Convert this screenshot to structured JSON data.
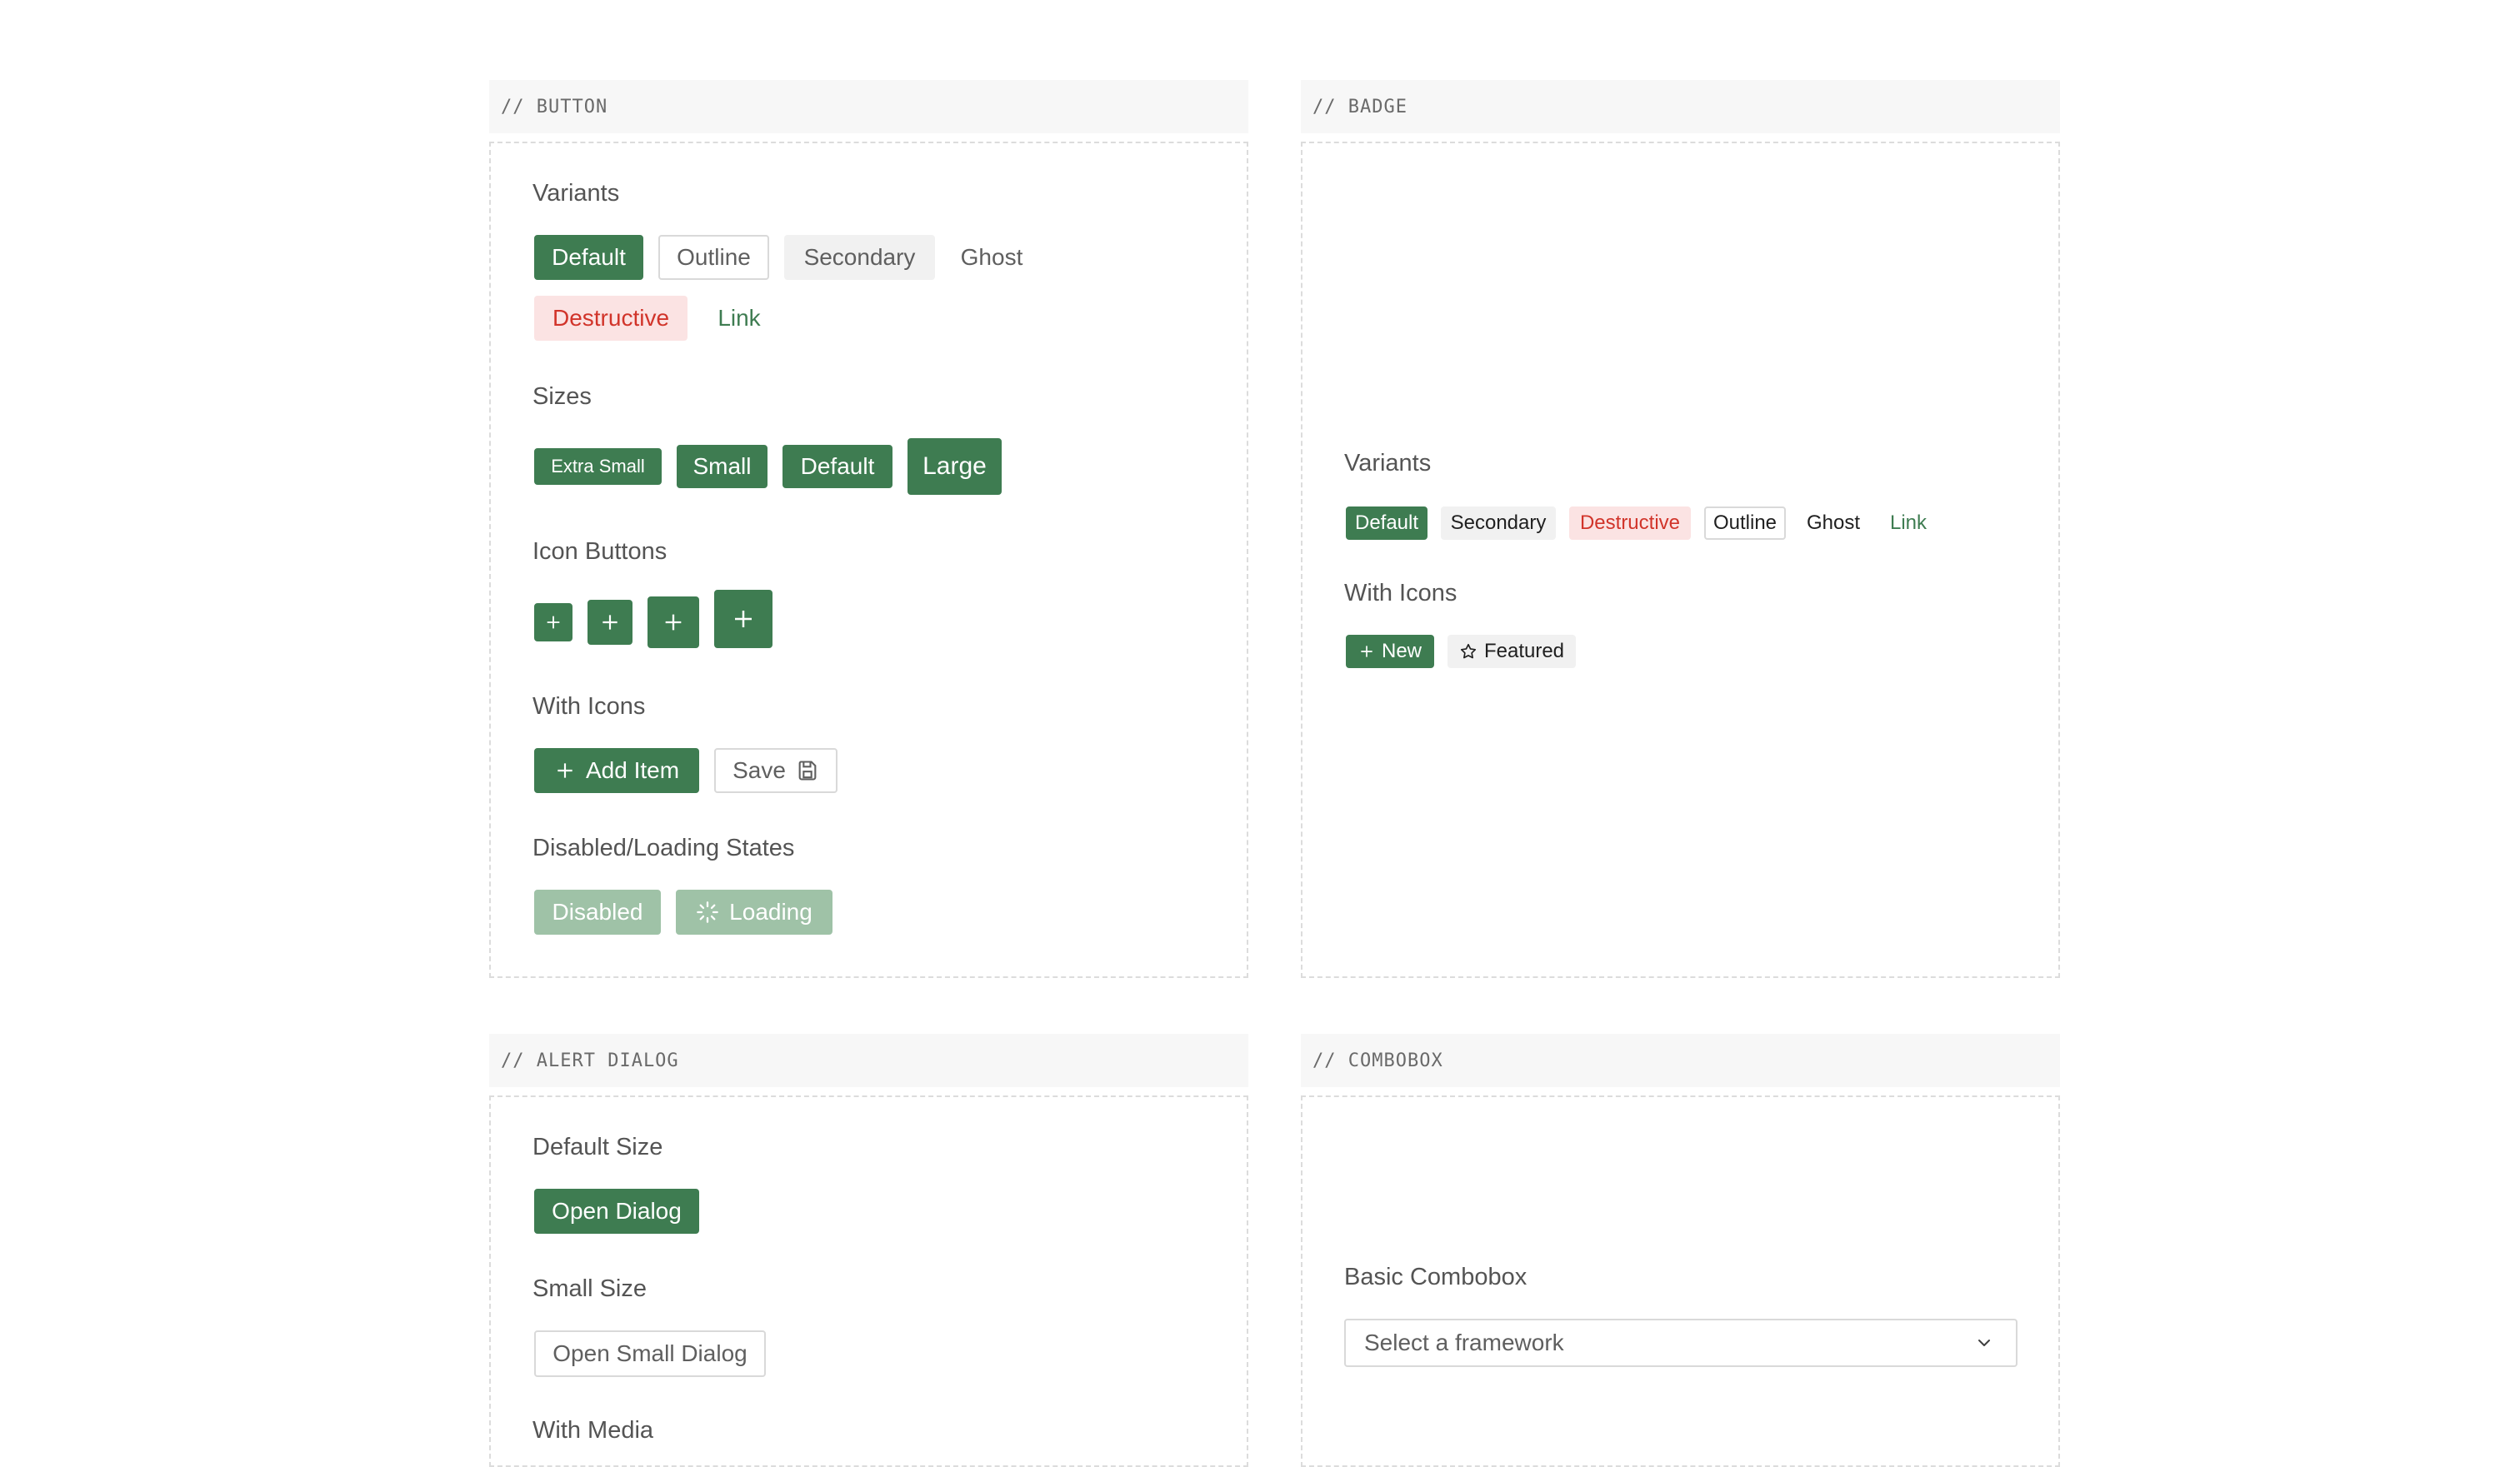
{
  "button_panel": {
    "header": "// BUTTON",
    "variants_title": "Variants",
    "variants": {
      "default": "Default",
      "outline": "Outline",
      "secondary": "Secondary",
      "ghost": "Ghost",
      "destructive": "Destructive",
      "link": "Link"
    },
    "sizes_title": "Sizes",
    "sizes": {
      "xs": "Extra Small",
      "sm": "Small",
      "default": "Default",
      "lg": "Large"
    },
    "icon_buttons_title": "Icon Buttons",
    "with_icons_title": "With Icons",
    "with_icons": {
      "add_item": "Add Item",
      "save": "Save"
    },
    "states_title": "Disabled/Loading States",
    "states": {
      "disabled": "Disabled",
      "loading": "Loading"
    }
  },
  "badge_panel": {
    "header": "// BADGE",
    "variants_title": "Variants",
    "variants": {
      "default": "Default",
      "secondary": "Secondary",
      "destructive": "Destructive",
      "outline": "Outline",
      "ghost": "Ghost",
      "link": "Link"
    },
    "with_icons_title": "With Icons",
    "with_icons": {
      "new": "New",
      "featured": "Featured"
    }
  },
  "alert_dialog_panel": {
    "header": "// ALERT DIALOG",
    "default_size_title": "Default Size",
    "open_dialog": "Open Dialog",
    "small_size_title": "Small Size",
    "open_small_dialog": "Open Small Dialog",
    "with_media_title": "With Media"
  },
  "combobox_panel": {
    "header": "// COMBOBOX",
    "basic_title": "Basic Combobox",
    "placeholder": "Select a framework"
  },
  "colors": {
    "primary": "#3e7c51",
    "destructive_text": "#d1342a",
    "destructive_bg": "#fbe3e3",
    "secondary_bg": "#f1f1f1",
    "disabled_bg": "#9fc2a7"
  },
  "icons": {
    "plus": "plus-icon",
    "save": "save-icon",
    "spinner": "spinner-icon",
    "star": "star-icon",
    "chevron": "chevron-down-icon"
  }
}
